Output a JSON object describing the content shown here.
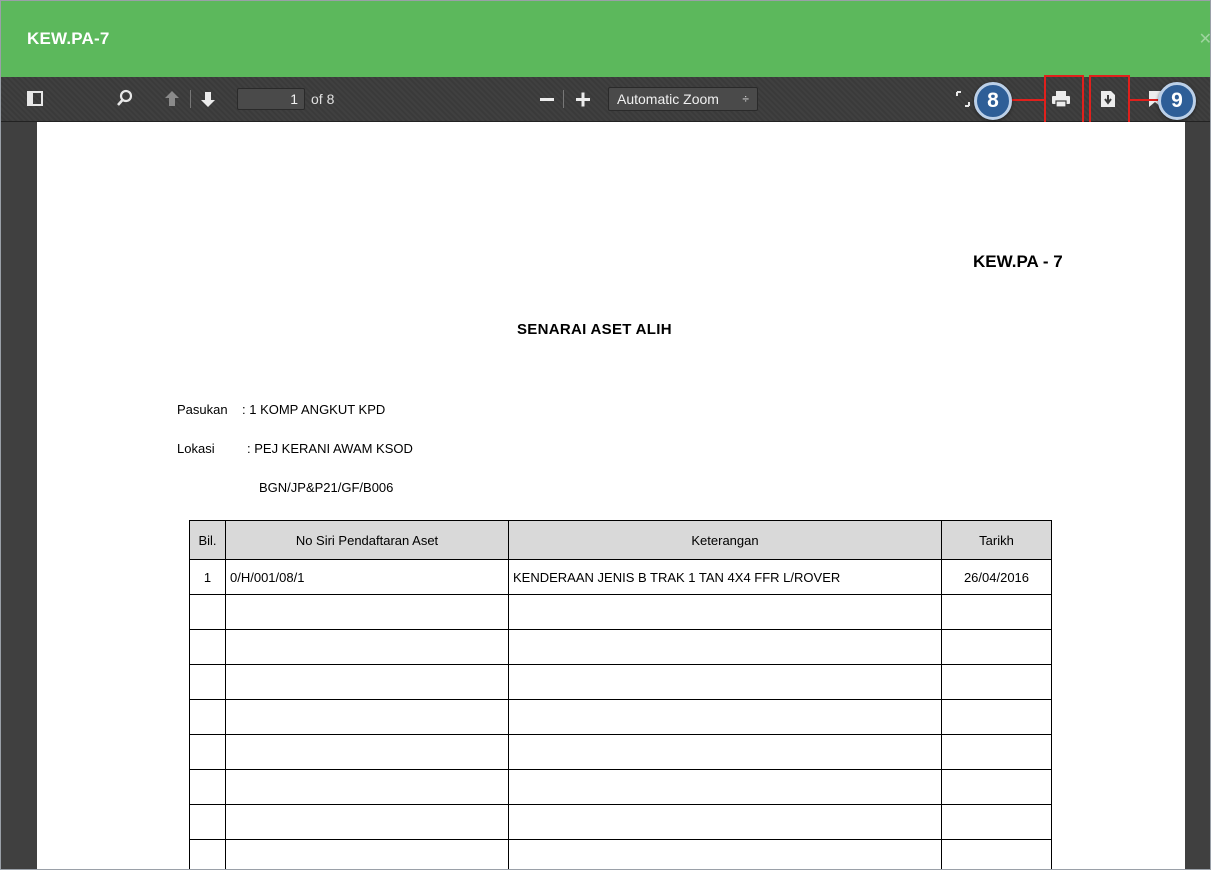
{
  "dialog": {
    "title": "KEW.PA-7",
    "close_icon": "close-icon"
  },
  "toolbar": {
    "page_number": "1",
    "page_of": "of 8",
    "zoom_minus": "—",
    "zoom_plus": "+",
    "zoom_value": "Automatic Zoom",
    "zoom_arrow": "÷",
    "icons": [
      "sidebar-toggle-icon",
      "search-icon",
      "previous-page-icon",
      "next-page-icon",
      "zoom-out-icon",
      "zoom-in-icon",
      "fullscreen-icon",
      "print-icon",
      "download-icon",
      "bookmark-icon"
    ]
  },
  "document": {
    "code": "KEW.PA - 7",
    "title": "SENARAI ASET ALIH",
    "pasukan_label": "Pasukan",
    "pasukan_value": ": 1 KOMP ANGKUT KPD",
    "lokasi_label": "Lokasi",
    "lokasi_value": ": PEJ KERANI AWAM KSOD",
    "lokasi_value2": "BGN/JP&P21/GF/B006",
    "table": {
      "headers": [
        "Bil.",
        "No Siri Pendaftaran Aset",
        "Keterangan",
        "Tarikh"
      ],
      "rows": [
        [
          "1",
          "0/H/001/08/1",
          "KENDERAAN JENIS B TRAK 1 TAN 4X4 FFR L/ROVER",
          "26/04/2016"
        ],
        [
          "",
          "",
          "",
          ""
        ],
        [
          "",
          "",
          "",
          ""
        ],
        [
          "",
          "",
          "",
          ""
        ],
        [
          "",
          "",
          "",
          ""
        ],
        [
          "",
          "",
          "",
          ""
        ],
        [
          "",
          "",
          "",
          ""
        ],
        [
          "",
          "",
          "",
          ""
        ],
        [
          "",
          "",
          "",
          ""
        ]
      ]
    }
  },
  "annotations": {
    "badge_print": "8",
    "badge_download": "9",
    "accent": "#e0201c",
    "badge_color": "#2e5e97"
  }
}
